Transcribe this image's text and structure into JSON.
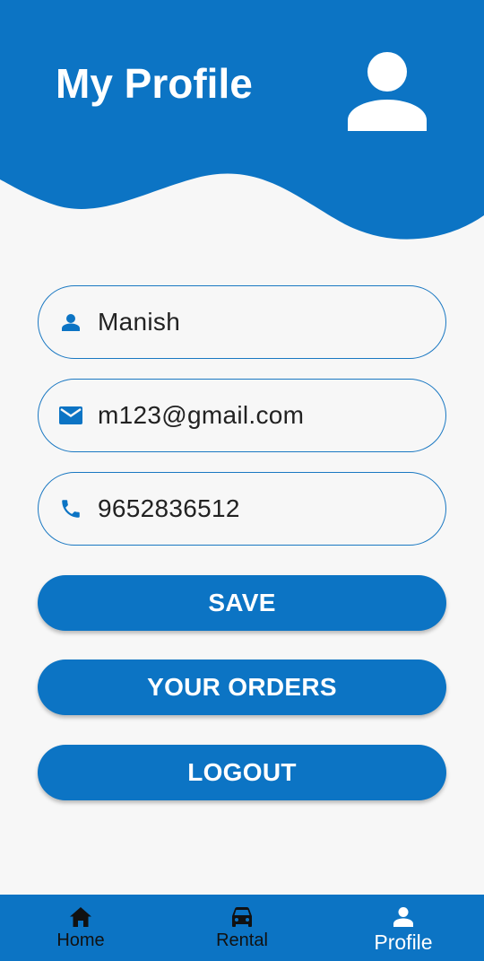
{
  "header": {
    "title": "My Profile",
    "avatar_icon": "person-icon",
    "color": "#0c74c4"
  },
  "form": {
    "name": {
      "icon": "person-icon",
      "value": "Manish"
    },
    "email": {
      "icon": "mail-icon",
      "value": "m123@gmail.com"
    },
    "phone": {
      "icon": "phone-icon",
      "value": "9652836512"
    }
  },
  "buttons": {
    "save": "SAVE",
    "orders": "YOUR ORDERS",
    "logout": "LOGOUT"
  },
  "bottom_nav": {
    "items": [
      {
        "label": "Home",
        "icon": "home-icon",
        "active": false
      },
      {
        "label": "Rental",
        "icon": "car-icon",
        "active": false
      },
      {
        "label": "Profile",
        "icon": "person-icon",
        "active": true
      }
    ]
  },
  "colors": {
    "primary": "#0c74c4",
    "background": "#f7f7f7",
    "field_border": "#1a78c2"
  }
}
